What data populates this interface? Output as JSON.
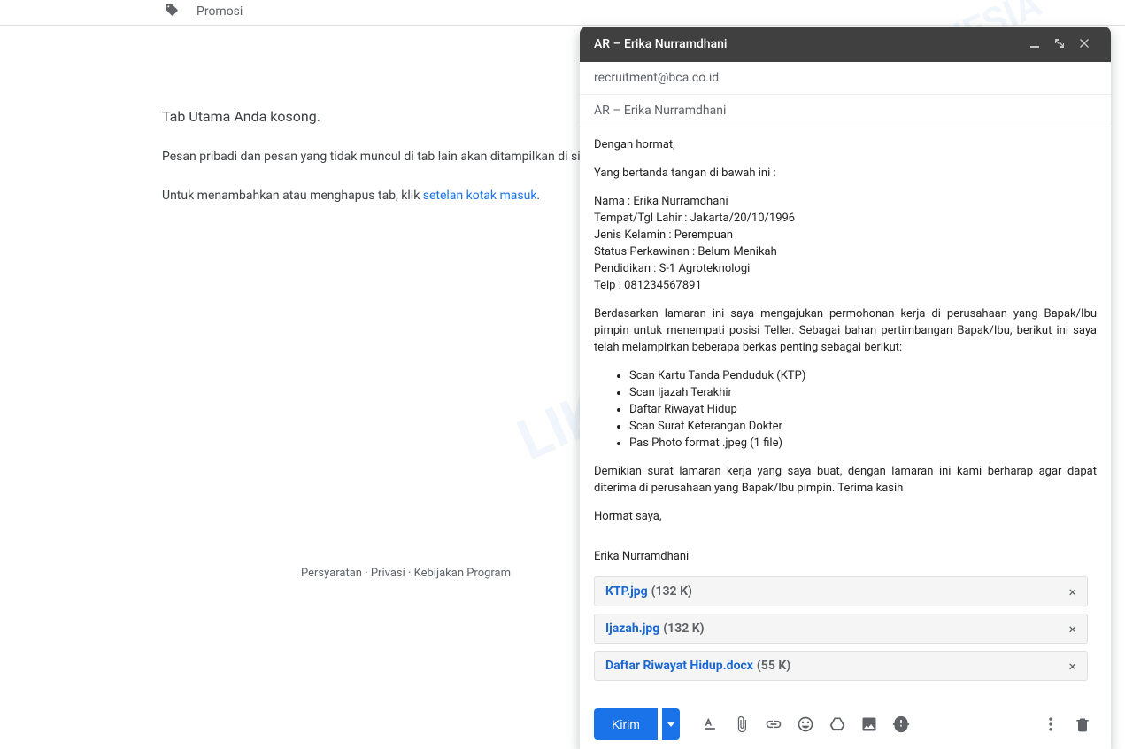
{
  "tabs": {
    "promo": "Promosi"
  },
  "empty_state": {
    "heading": "Tab Utama Anda kosong.",
    "line1_a": "Pesan pribadi dan pesan yang tidak muncul di tab lain akan ditampilkan di si",
    "line2_a": "Untuk menambahkan atau menghapus tab, klik ",
    "link": "setelan kotak masuk",
    "line2_b": "."
  },
  "footer": {
    "terms": "Persyaratan",
    "privacy": "Privasi",
    "program": "Kebijakan Program",
    "sep": " · "
  },
  "compose": {
    "title": "AR – Erika Nurramdhani",
    "to": "recruitment@bca.co.id",
    "subject": "AR – Erika Nurramdhani",
    "body": {
      "p1": "Dengan hormat,",
      "p2": "Yang bertanda tangan di bawah ini :",
      "d1": "Nama : Erika Nurramdhani",
      "d2": "Tempat/Tgl Lahir : Jakarta/20/10/1996",
      "d3": "Jenis Kelamin : Perempuan",
      "d4": "Status Perkawinan : Belum Menikah",
      "d5": "Pendidikan : S-1 Agroteknologi",
      "d6": "Telp : 081234567891",
      "p3": "Berdasarkan lamaran ini saya mengajukan permohonan kerja di perusahaan yang Bapak/Ibu pimpin untuk menempati posisi Teller. Sebagai bahan pertimbangan Bapak/Ibu, berikut ini saya telah melampirkan beberapa berkas penting sebagai berikut:",
      "li1": "Scan Kartu Tanda Penduduk (KTP)",
      "li2": "Scan Ijazah Terakhir",
      "li3": "Daftar Riwayat Hidup",
      "li4": "Scan Surat Keterangan Dokter",
      "li5": "Pas Photo format .jpeg (1 file)",
      "p4": "Demikian surat lamaran kerja yang saya buat, dengan lamaran ini kami berharap agar dapat diterima di perusahaan yang Bapak/Ibu pimpin. Terima kasih",
      "p5": "Hormat saya,",
      "sig": "Erika Nurramdhani"
    },
    "attachments": [
      {
        "name": "KTP.jpg",
        "size": "(132 K)"
      },
      {
        "name": "Ijazah.jpg",
        "size": "(132 K)"
      },
      {
        "name": "Daftar Riwayat Hidup.docx",
        "size": "(55 K)"
      }
    ],
    "send": "Kirim"
  }
}
